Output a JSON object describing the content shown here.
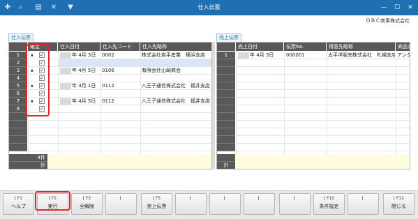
{
  "window": {
    "title": "仕入伝票",
    "toolbar_icons": [
      "new-add-icon",
      "search-icon",
      "print-icon",
      "delete-icon",
      "dropdown-icon"
    ],
    "controls": [
      "minimize-icon",
      "maximize-icon",
      "close-icon"
    ]
  },
  "company": "ＯＢＣ商事株式会社",
  "left": {
    "tab_label": "仕入伝票",
    "columns": [
      "確定",
      "仕入日付",
      "仕入先コード",
      "仕入先略称"
    ],
    "rows": [
      {
        "no": "1",
        "arrow": "▲",
        "checked": "✓",
        "date": "年  4月  3日",
        "code": "0002",
        "name": "株式会社岩手産業　横浜支店"
      },
      {
        "no": "2",
        "arrow": "",
        "checked": "✓",
        "date": "",
        "code": "",
        "name": ""
      },
      {
        "no": "3",
        "arrow": "▲",
        "checked": "✓",
        "date": "年  4月  5日",
        "code": "0106",
        "name": "有限会社山崎商会"
      },
      {
        "no": "4",
        "arrow": "",
        "checked": "✓",
        "date": "",
        "code": "",
        "name": ""
      },
      {
        "no": "5",
        "arrow": "▲",
        "checked": "✓",
        "date": "年  4月  1日",
        "code": "0112",
        "name": "八王子通信株式会社　福井支店"
      },
      {
        "no": "6",
        "arrow": "",
        "checked": "✓",
        "date": "",
        "code": "",
        "name": ""
      },
      {
        "no": "7",
        "arrow": "▲",
        "checked": "✓",
        "date": "年  4月  5日",
        "code": "0112",
        "name": "八王子通信株式会社　福井支店"
      },
      {
        "no": "8",
        "arrow": "",
        "checked": "✓",
        "date": "",
        "code": "",
        "name": ""
      }
    ],
    "footer_count": "4件",
    "footer_total": "計"
  },
  "right": {
    "tab_label": "売上伝票",
    "columns": [
      "売上日付",
      "伝票No.",
      "得意先略称",
      "商品名"
    ],
    "rows": [
      {
        "no": "1",
        "date": "年  4月  3日",
        "voucher": "000001",
        "customer": "太平洋販売株式会社　札幌支店",
        "product": "アンダ"
      }
    ],
    "footer_total": "計"
  },
  "fkeys": [
    {
      "key": "F1",
      "label": "ヘルプ"
    },
    {
      "key": "F2",
      "label": "実行"
    },
    {
      "key": "F3",
      "label": "全解除"
    },
    {
      "key": "",
      "label": ""
    },
    {
      "key": "F5",
      "label": "売上伝票"
    },
    {
      "key": "",
      "label": ""
    },
    {
      "key": "",
      "label": ""
    },
    {
      "key": "",
      "label": ""
    },
    {
      "key": "",
      "label": ""
    },
    {
      "key": "F10",
      "label": "条件設定"
    },
    {
      "key": "",
      "label": ""
    },
    {
      "key": "F12",
      "label": "閉じる"
    }
  ],
  "colors": {
    "titlebar": "#1f6fb3",
    "header": "#595959",
    "highlight_red": "#e3262b",
    "selected_row": "#dce4f8",
    "footer": "#fffde0"
  }
}
